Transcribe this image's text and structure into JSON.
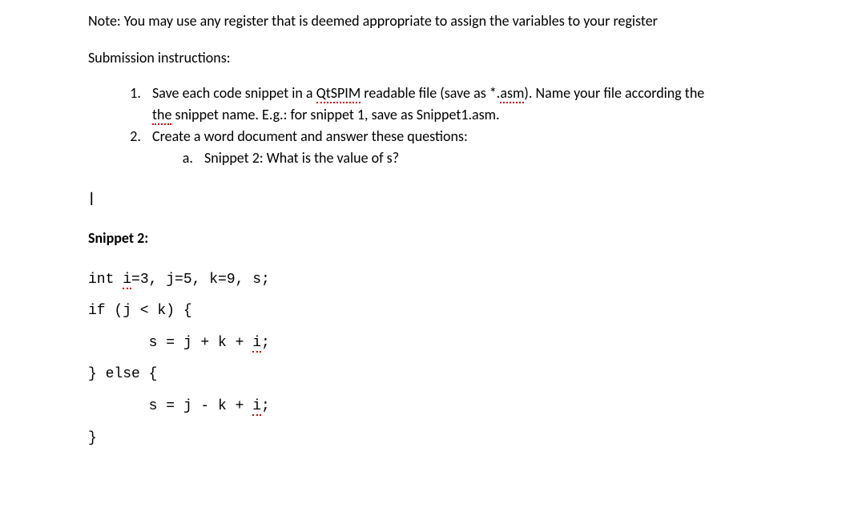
{
  "note": "Note:  You may use any register that is deemed appropriate to assign the variables to your register",
  "submission": {
    "title": "Submission instructions:",
    "items": [
      {
        "prefix": "Save each code snippet in a ",
        "word1": "QtSPIM",
        "mid1": " readable file (save as *.",
        "word2": "asm",
        "mid2": ").  Name your file according the ",
        "word3": "the",
        "suffix": " snippet name.  E.g.: for snippet 1, save as Snippet1.asm."
      },
      {
        "text": "Create a word document and answer these questions:",
        "sub": [
          "Snippet 2:  What is the value of s?"
        ]
      }
    ]
  },
  "cursor": "|",
  "snippet": {
    "title": "Snippet 2:",
    "line1_prefix": "int ",
    "line1_i": "i",
    "line1_rest": "=3, j=5, k=9, s;",
    "line2": "if (j < k) {",
    "line3_prefix": "       s = j + k + ",
    "line3_i": "i",
    "line3_suffix": ";",
    "line4": "} else {",
    "line5_prefix": "       s = j - k + ",
    "line5_i": "i",
    "line5_suffix": ";",
    "line6": "}"
  }
}
